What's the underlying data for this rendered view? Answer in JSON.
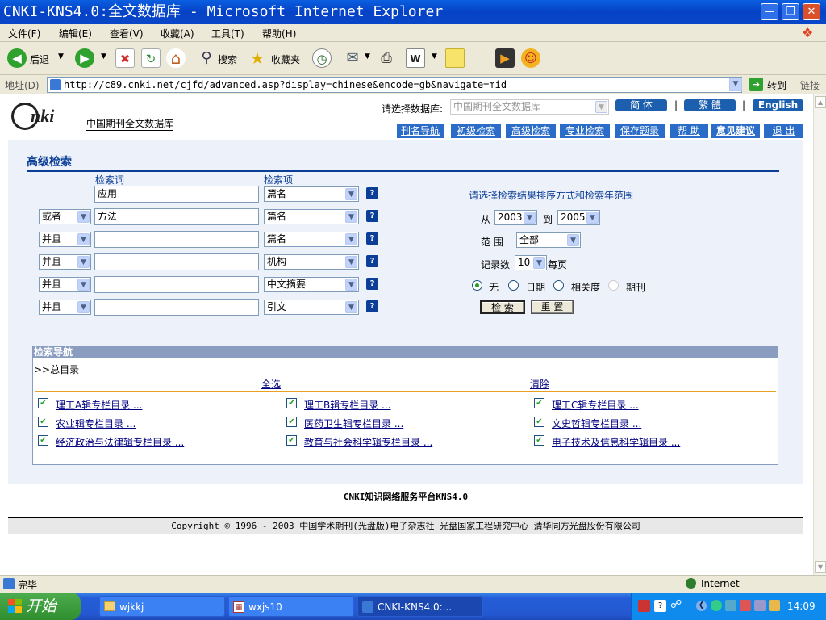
{
  "window": {
    "title": "CNKI-KNS4.0:全文数据库 - Microsoft Internet Explorer"
  },
  "menu": [
    "文件(F)",
    "编辑(E)",
    "查看(V)",
    "收藏(A)",
    "工具(T)",
    "帮助(H)"
  ],
  "toolbar": {
    "back": "后退",
    "search": "搜索",
    "favorites": "收藏夹"
  },
  "address": {
    "label": "地址(D)",
    "url": "http://c89.cnki.net/cjfd/advanced.asp?display=chinese&encode=gb&navigate=mid",
    "go": "转到",
    "links": "链接"
  },
  "page": {
    "logo_text": "中国期刊全文数据库",
    "db_label": "请选择数据库:",
    "db_value": "中国期刊全文数据库",
    "lang": [
      "简 体",
      "繁 體",
      "English"
    ],
    "nav_tabs": [
      "刊名导航",
      "初级检索",
      "高级检索",
      "专业检索",
      "保存题录",
      "帮 助",
      "意见建议",
      "退 出"
    ],
    "section_title": "高级检索",
    "col_term": "检索词",
    "col_field": "检索项",
    "rows": [
      {
        "logic": "",
        "term": "应用",
        "field": "篇名"
      },
      {
        "logic": "或者",
        "term": "方法",
        "field": "篇名"
      },
      {
        "logic": "并且",
        "term": "",
        "field": "篇名"
      },
      {
        "logic": "并且",
        "term": "",
        "field": "机构"
      },
      {
        "logic": "并且",
        "term": "",
        "field": "中文摘要"
      },
      {
        "logic": "并且",
        "term": "",
        "field": "引文"
      }
    ],
    "help_glyph": "?",
    "options_title": "请选择检索结果排序方式和检索年范围",
    "from_label": "从",
    "from_year": "2003",
    "to_label": "到",
    "to_year": "2005",
    "range_label": "范 围",
    "range_value": "全部",
    "records_label": "记录数",
    "records_value": "10",
    "per_page": "每页",
    "sort_options": [
      "无",
      "日期",
      "相关度",
      "期刊"
    ],
    "search_btn": "检 索",
    "reset_btn": "重 置",
    "nav_box_title": "检索导航",
    "nav_root": ">>总目录",
    "select_all": "全选",
    "clear": "清除",
    "categories": [
      "理工A辑专栏目录 ...",
      "理工B辑专栏目录 ...",
      "理工C辑专栏目录 ...",
      "农业辑专栏目录 ...",
      "医药卫生辑专栏目录 ...",
      "文史哲辑专栏目录 ...",
      "经济政治与法律辑专栏目录 ...",
      "教育与社会科学辑专栏目录 ...",
      "电子技术及信息科学辑目录 ..."
    ],
    "footer_title": "CNKI知识网络服务平台KNS4.0",
    "copyright": "Copyright © 1996 - 2003   中国学术期刊(光盘版)电子杂志社   光盘国家工程研究中心   清华同方光盘股份有限公司"
  },
  "status": {
    "text": "完毕",
    "zone": "Internet"
  },
  "taskbar": {
    "start": "开始",
    "tasks": [
      "wjkkj",
      "wxjs10",
      "CNKI-KNS4.0:..."
    ],
    "clock": "14:09"
  },
  "colors": {
    "accent": "#0b3e96",
    "tab": "#2a6cc8",
    "panel": "#edf1f9",
    "nav_header": "#8a9cbf"
  }
}
